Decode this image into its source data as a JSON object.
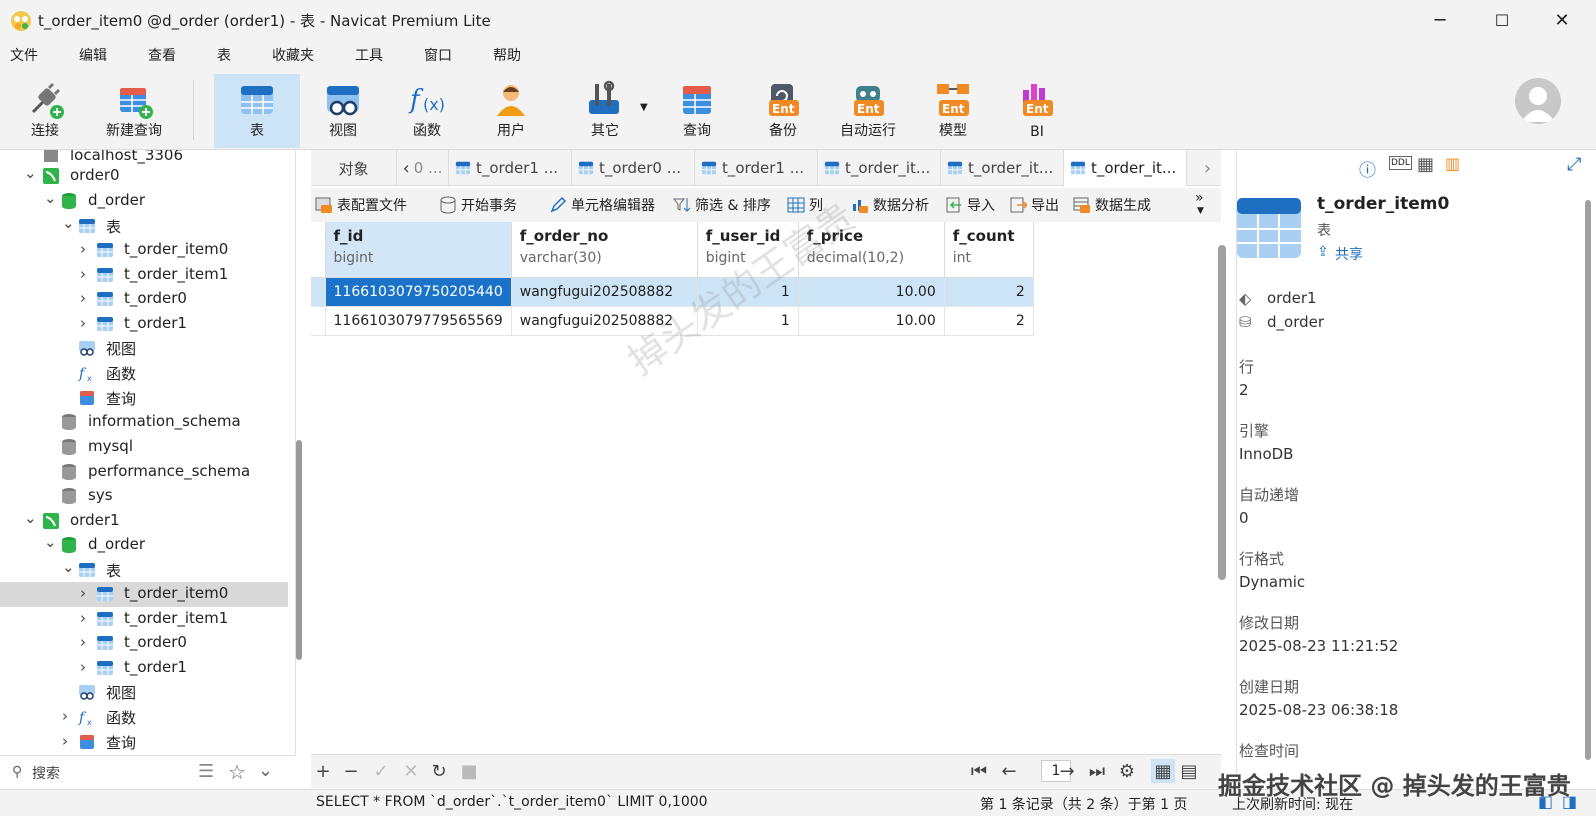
{
  "window": {
    "title": "t_order_item0 @d_order (order1) - 表 - Navicat Premium Lite"
  },
  "menu": [
    "文件",
    "编辑",
    "查看",
    "表",
    "收藏夹",
    "工具",
    "窗口",
    "帮助"
  ],
  "toolbar": {
    "connect": "连接",
    "new_query": "新建查询",
    "table": "表",
    "view": "视图",
    "function": "函数",
    "user": "用户",
    "other": "其它",
    "query": "查询",
    "backup": "备份",
    "automation": "自动运行",
    "model": "模型",
    "bi": "BI"
  },
  "sidebar": {
    "rows": [
      {
        "label": "localhost_3306"
      },
      {
        "label": "order0"
      },
      {
        "label": "d_order"
      },
      {
        "label": "表"
      },
      {
        "label": "t_order_item0"
      },
      {
        "label": "t_order_item1"
      },
      {
        "label": "t_order0"
      },
      {
        "label": "t_order1"
      },
      {
        "label": "视图"
      },
      {
        "label": "函数"
      },
      {
        "label": "查询"
      },
      {
        "label": "information_schema"
      },
      {
        "label": "mysql"
      },
      {
        "label": "performance_schema"
      },
      {
        "label": "sys"
      },
      {
        "label": "order1"
      },
      {
        "label": "d_order"
      },
      {
        "label": "表"
      },
      {
        "label": "t_order_item0"
      },
      {
        "label": "t_order_item1"
      },
      {
        "label": "t_order0"
      },
      {
        "label": "t_order1"
      },
      {
        "label": "视图"
      },
      {
        "label": "函数"
      },
      {
        "label": "查询"
      }
    ],
    "search_placeholder": "搜索"
  },
  "tabs": {
    "objects": "对象",
    "items": [
      "t_order1 ...",
      "t_order0 ...",
      "t_order1 ...",
      "t_order_it...",
      "t_order_it...",
      "t_order_it..."
    ]
  },
  "subtoolbar": {
    "table_profile": "表配置文件",
    "begin_transaction": "开始事务",
    "cell_editor": "单元格编辑器",
    "filter_sort": "筛选 & 排序",
    "columns": "列",
    "data_analysis": "数据分析",
    "import": "导入",
    "export": "导出",
    "data_generation": "数据生成"
  },
  "grid": {
    "columns": [
      {
        "name": "f_id",
        "type": "bigint"
      },
      {
        "name": "f_order_no",
        "type": "varchar(30)"
      },
      {
        "name": "f_user_id",
        "type": "bigint"
      },
      {
        "name": "f_price",
        "type": "decimal(10,2)"
      },
      {
        "name": "f_count",
        "type": "int"
      }
    ],
    "rows": [
      [
        "1166103079750205440",
        "wangfugui202508882",
        "1",
        "10.00",
        "2"
      ],
      [
        "1166103079779565569",
        "wangfugui202508882",
        "1",
        "10.00",
        "2"
      ]
    ]
  },
  "pager": {
    "page": "1"
  },
  "status": {
    "sql": "SELECT * FROM `d_order`.`t_order_item0` LIMIT 0,1000",
    "records": "第 1 条记录（共 2 条）于第 1 页",
    "refresh": "上次刷新时间: 现在"
  },
  "info": {
    "name": "t_order_item0",
    "kind": "表",
    "share": "共享",
    "connection": "order1",
    "database": "d_order",
    "rows_label": "行",
    "rows_value": "2",
    "engine_label": "引擎",
    "engine_value": "InnoDB",
    "autoinc_label": "自动递增",
    "autoinc_value": "0",
    "rowformat_label": "行格式",
    "rowformat_value": "Dynamic",
    "modified_label": "修改日期",
    "modified_value": "2025-08-23 11:21:52",
    "created_label": "创建日期",
    "created_value": "2025-08-23 06:38:18",
    "checked_label": "检查时间"
  },
  "watermark": {
    "text": "掉头发的王富贵",
    "credit": "掘金技术社区 @ 掉头发的王富贵"
  }
}
